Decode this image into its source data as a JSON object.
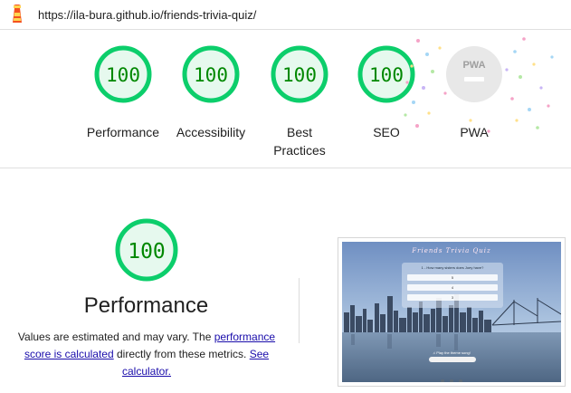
{
  "address_bar": {
    "url": "https://ila-bura.github.io/friends-trivia-quiz/"
  },
  "summary": {
    "gauges": [
      {
        "score": "100",
        "label": "Performance",
        "status": "pass"
      },
      {
        "score": "100",
        "label": "Accessibility",
        "status": "pass"
      },
      {
        "score": "100",
        "label": "Best Practices",
        "status": "pass"
      },
      {
        "score": "100",
        "label": "SEO",
        "status": "pass"
      },
      {
        "score": "PWA",
        "label": "PWA",
        "status": "neutral"
      }
    ]
  },
  "detail": {
    "score": "100",
    "title": "Performance",
    "text_before": "Values are estimated and may vary. The ",
    "link_score": "performance score is calculated",
    "text_middle": " directly from these metrics. ",
    "link_calc": "See calculator."
  },
  "screenshot": {
    "title": "Friends Trivia Quiz",
    "question": "1 - How many sisters does Joey have?",
    "options": [
      "5",
      "4",
      "3"
    ],
    "play_text": "♫ Play the theme song!"
  },
  "colors": {
    "pass": "#0cce6b",
    "pass_fill": "#e6f9ee",
    "pass_text": "#008800",
    "neutral": "#e0e0e0",
    "link": "#1a0dab"
  }
}
